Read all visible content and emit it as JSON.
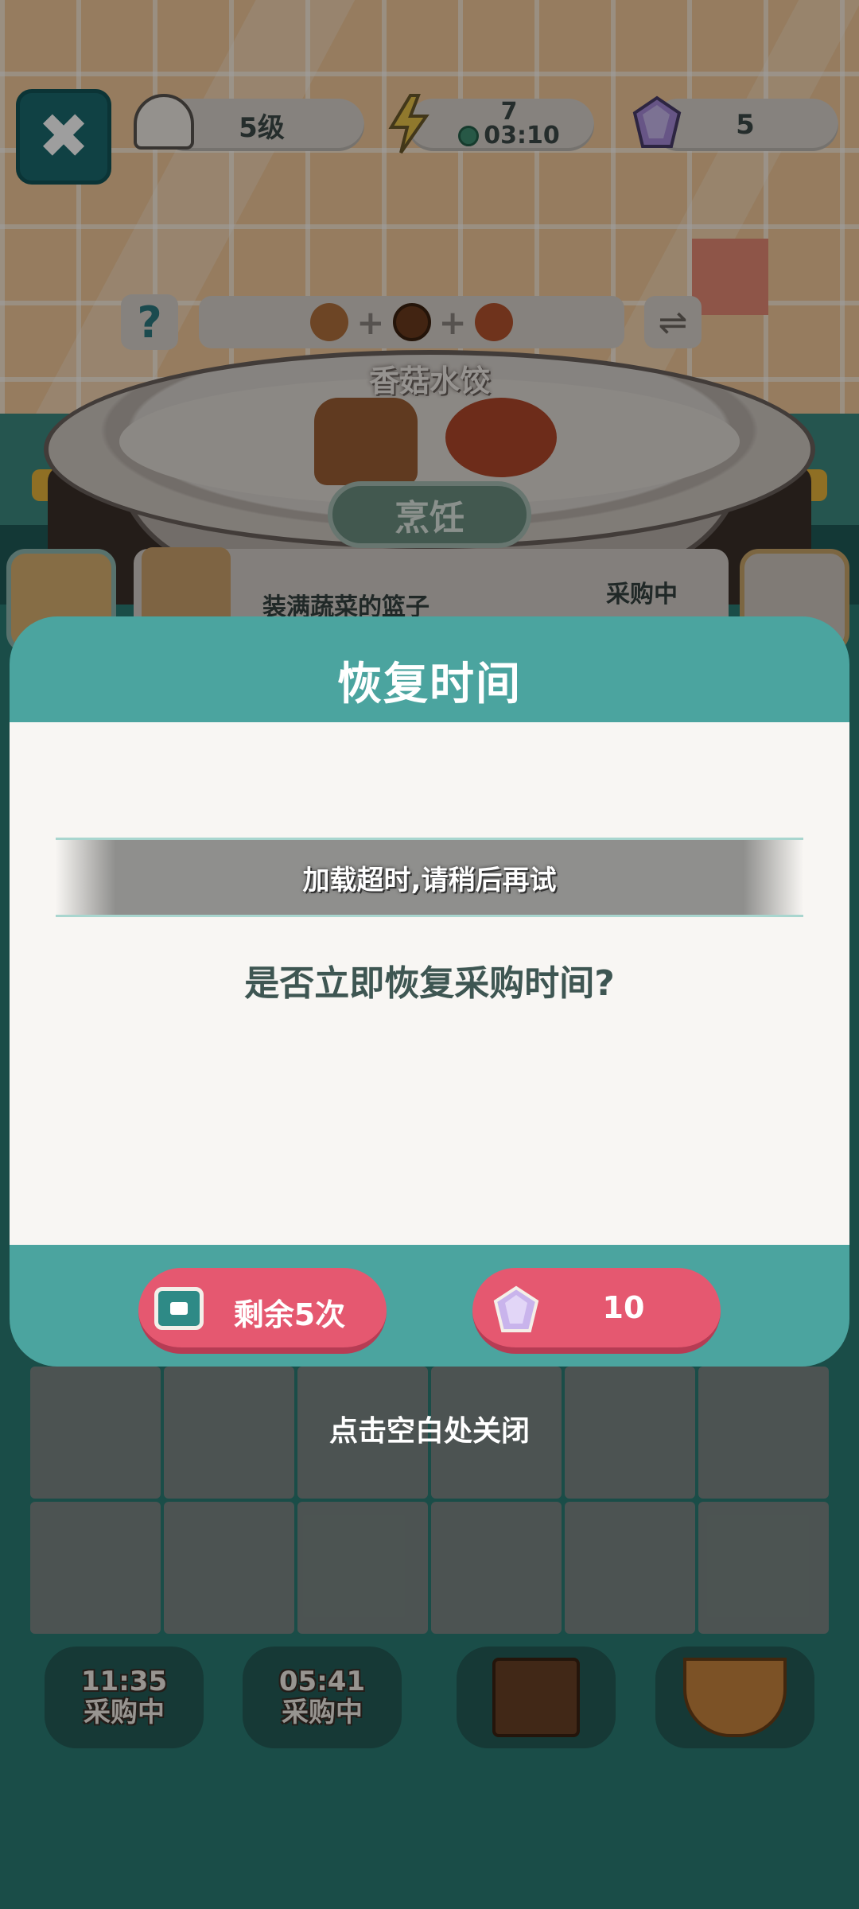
{
  "hud": {
    "level": "5级",
    "energy": "7",
    "energy_timer": "03:10",
    "gems": "5"
  },
  "recipe": {
    "dish_name": "香菇水饺",
    "cook_button": "烹饪",
    "help": "?",
    "swap": "⇌"
  },
  "order": {
    "name": "装满蔬菜的篮子",
    "status": "采购中"
  },
  "modal": {
    "title": "恢复时间",
    "toast": "加载超时,请稍后再试",
    "question": "是否立即恢复采购时间?",
    "ad_button": "剩余5次",
    "gem_button": "10",
    "close_hint": "点击空白处关闭"
  },
  "shelf": [
    {
      "time": "11:35",
      "status": "采购中"
    },
    {
      "time": "05:41",
      "status": "采购中"
    }
  ],
  "colors": {
    "modal_teal": "#4ba49f",
    "button_red": "#e55870",
    "background": "#1f5b57"
  }
}
